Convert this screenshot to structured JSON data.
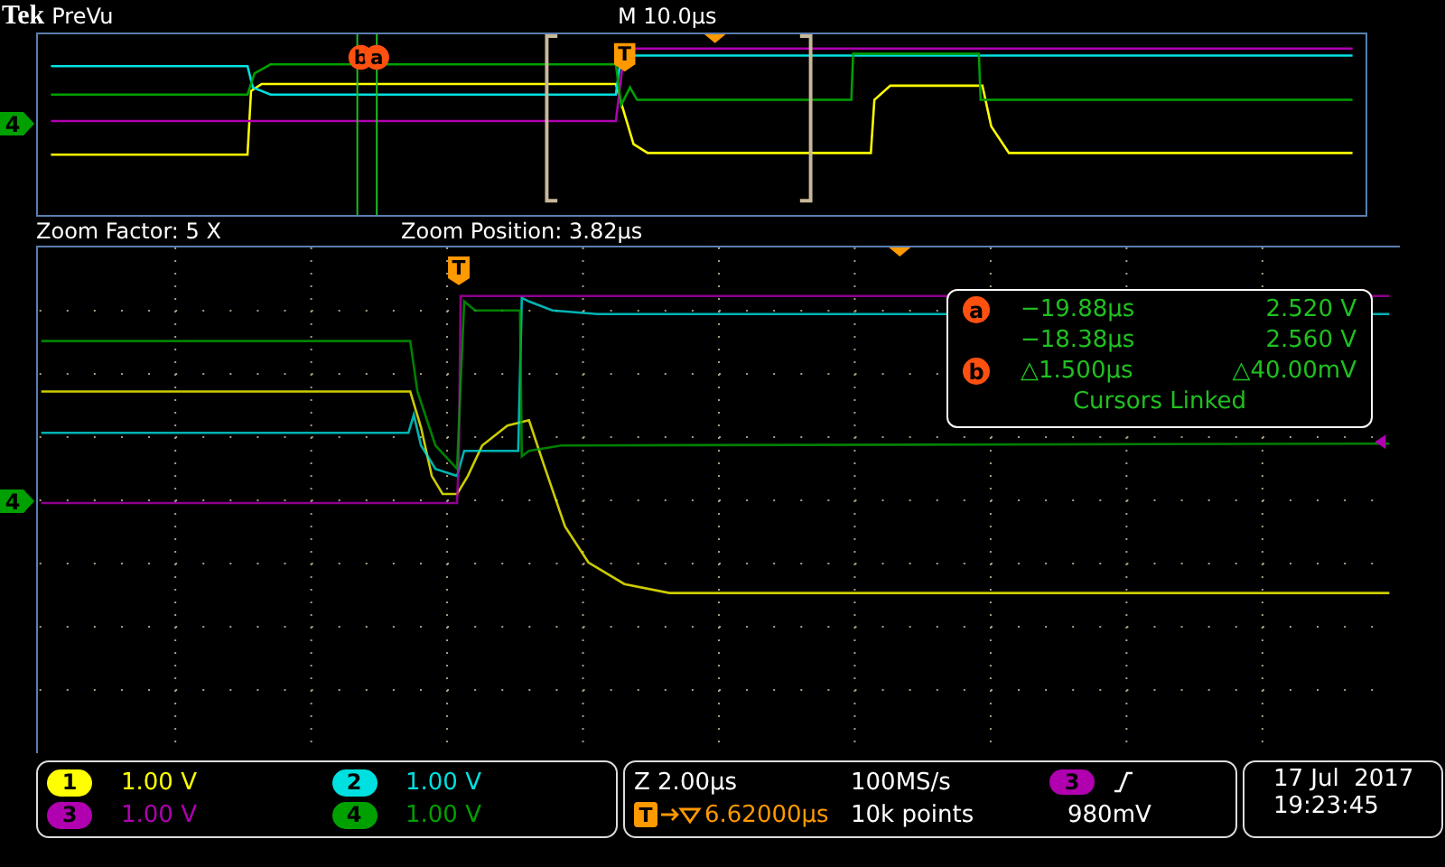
{
  "header": {
    "brand": "Tek",
    "mode": "PreVu",
    "timebase": "M 10.0µs"
  },
  "overview": {
    "channel_marker": "4",
    "cursor_badges": [
      "b",
      "a"
    ],
    "trigger_marker": "T"
  },
  "zoom": {
    "factor": "Zoom Factor: 5 X",
    "position": "Zoom Position: 3.82µs"
  },
  "main": {
    "channel_marker": "4",
    "trigger_marker": "T"
  },
  "cursor_readout": {
    "rows": [
      {
        "badge": "a",
        "time": "−19.88µs",
        "value": "2.520 V"
      },
      {
        "time": "−18.38µs",
        "value": "2.560 V"
      },
      {
        "badge": "b",
        "time": "△1.500µs",
        "value": "△40.00mV"
      }
    ],
    "status": "Cursors Linked"
  },
  "channels": [
    {
      "number": "1",
      "scale": "1.00 V",
      "color": "#ffff00"
    },
    {
      "number": "2",
      "scale": "1.00 V",
      "color": "#00e0e0"
    },
    {
      "number": "3",
      "scale": "1.00 V",
      "color": "#b000b0"
    },
    {
      "number": "4",
      "scale": "1.00 V",
      "color": "#00a000"
    }
  ],
  "acquisition": {
    "zoom_scale": "Z 2.00µs",
    "trigger_marker": "T",
    "trigger_position": "6.62000µs",
    "sample_rate": "100MS/s",
    "record_length": "10k points",
    "trigger_source": {
      "label": "3",
      "color": "#b000b0"
    },
    "trigger_level": "980mV"
  },
  "datetime": {
    "date": "17 Jul  2017",
    "time": "19:23:45"
  }
}
